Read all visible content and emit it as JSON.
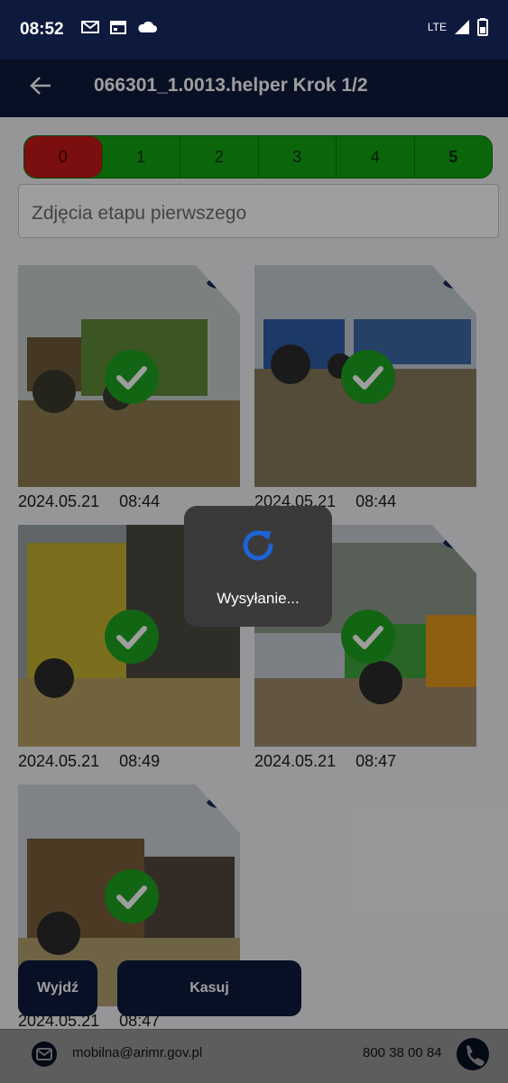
{
  "status_bar": {
    "time": "08:52",
    "network": "LTE"
  },
  "app_bar": {
    "title": "066301_1.0013.helper Krok 1/2"
  },
  "steps": [
    "0",
    "1",
    "2",
    "3",
    "4",
    "5"
  ],
  "description": {
    "placeholder": "Zdjęcia etapu pierwszego"
  },
  "photos": [
    {
      "date": "2024.05.21",
      "time": "08:44"
    },
    {
      "date": "2024.05.21",
      "time": "08:44"
    },
    {
      "date": "2024.05.21",
      "time": "08:49"
    },
    {
      "date": "2024.05.21",
      "time": "08:47"
    },
    {
      "date": "2024.05.21",
      "time": "08:47"
    }
  ],
  "loading": {
    "message": "Wysyłanie..."
  },
  "buttons": {
    "exit": "Wyjdź",
    "delete": "Kasuj"
  },
  "footer": {
    "email": "mobilna@arimr.gov.pl",
    "phone": "800 38 00 84"
  },
  "colors": {
    "primary": "#0e1a3d",
    "step_active": "#c71818",
    "step_done": "#13a513",
    "check": "#1ea31e",
    "spinner": "#1e63d6"
  }
}
